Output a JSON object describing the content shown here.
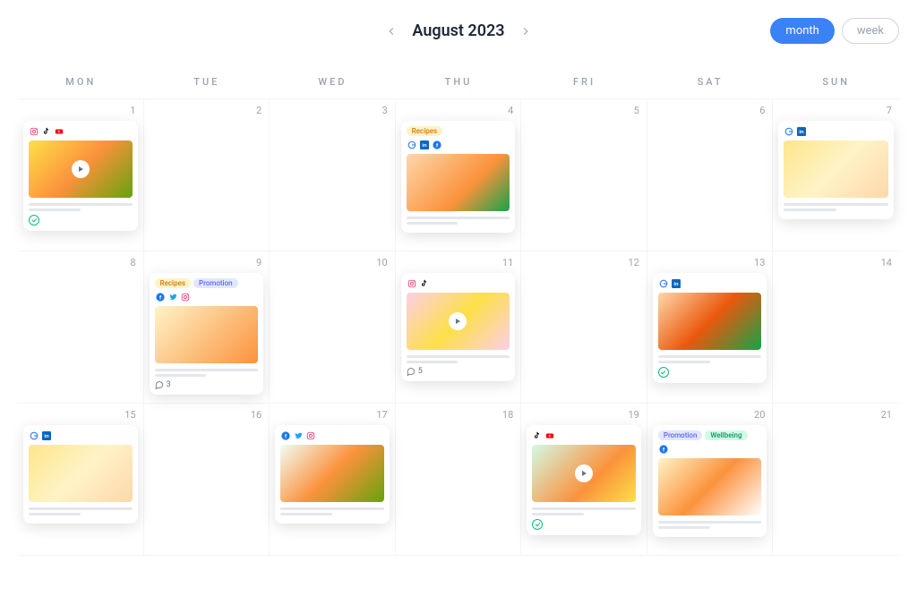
{
  "header": {
    "title": "August 2023",
    "views": {
      "month": "month",
      "week": "week"
    }
  },
  "days": [
    "MON",
    "TUE",
    "WED",
    "THU",
    "FRI",
    "SAT",
    "SUN"
  ],
  "dates": [
    1,
    2,
    3,
    4,
    5,
    6,
    7,
    8,
    9,
    10,
    11,
    12,
    13,
    14,
    15,
    16,
    17,
    18,
    19,
    20,
    21
  ],
  "tags": {
    "recipes": "Recipes",
    "promotion": "Promotion",
    "wellbeing": "Wellbeing"
  },
  "cards": {
    "d1": {
      "icons": [
        "instagram",
        "tiktok",
        "youtube"
      ],
      "video": true,
      "thumb": "t1",
      "check": true
    },
    "d4": {
      "tags": [
        "recipes"
      ],
      "icons": [
        "google",
        "linkedin",
        "facebook"
      ],
      "thumb": "t2"
    },
    "d7": {
      "icons": [
        "google",
        "linkedin"
      ],
      "thumb": "t3"
    },
    "d9": {
      "tags": [
        "recipes",
        "promotion"
      ],
      "icons": [
        "facebook",
        "twitter",
        "instagram"
      ],
      "thumb": "t4",
      "comments": "3"
    },
    "d11": {
      "icons": [
        "instagram",
        "tiktok"
      ],
      "video": true,
      "thumb": "t5",
      "comments": "5"
    },
    "d13": {
      "icons": [
        "google",
        "linkedin"
      ],
      "thumb": "t6",
      "check": true
    },
    "d15": {
      "icons": [
        "google",
        "linkedin"
      ],
      "thumb": "t3"
    },
    "d17": {
      "icons": [
        "facebook",
        "twitter",
        "instagram"
      ],
      "thumb": "t7"
    },
    "d19": {
      "icons": [
        "tiktok",
        "youtube"
      ],
      "video": true,
      "thumb": "t8",
      "check": true
    },
    "d20": {
      "tags": [
        "promotion",
        "wellbeing"
      ],
      "icons": [
        "facebook"
      ],
      "thumb": "t9"
    }
  }
}
